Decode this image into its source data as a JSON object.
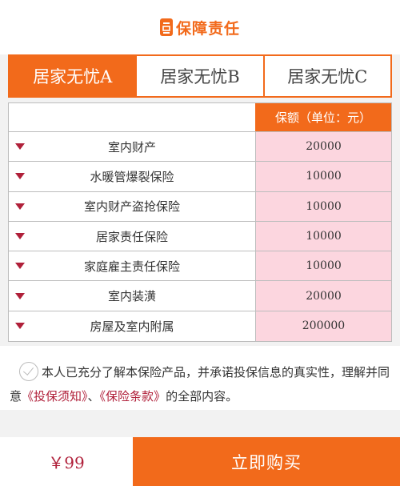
{
  "header": {
    "title": "保障责任",
    "icon": "document-icon"
  },
  "tabs": [
    {
      "label": "居家无忧A",
      "active": true
    },
    {
      "label": "居家无忧B",
      "active": false
    },
    {
      "label": "居家无忧C",
      "active": false
    }
  ],
  "table": {
    "amount_header": "保额（单位：元）",
    "rows": [
      {
        "name": "室内财产",
        "amount": "20000"
      },
      {
        "name": "水暖管爆裂保险",
        "amount": "10000"
      },
      {
        "name": "室内财产盗抢保险",
        "amount": "10000"
      },
      {
        "name": "居家责任保险",
        "amount": "10000"
      },
      {
        "name": "家庭雇主责任保险",
        "amount": "10000"
      },
      {
        "name": "室内装潢",
        "amount": "20000"
      },
      {
        "name": "房屋及室内附属",
        "amount": "200000"
      }
    ]
  },
  "agreement": {
    "text_1": "本人已充分了解本保险产品，并承诺投保信息的真实性，理解并同意",
    "link_notice": "《投保须知》",
    "separator": "、",
    "link_terms": "《保险条款》",
    "text_2": "的全部内容。"
  },
  "footer": {
    "price": "￥99",
    "buy_label": "立即购买"
  },
  "colors": {
    "accent": "#f26a1b",
    "link": "#b0203a",
    "amount_bg": "#fcd6df"
  }
}
